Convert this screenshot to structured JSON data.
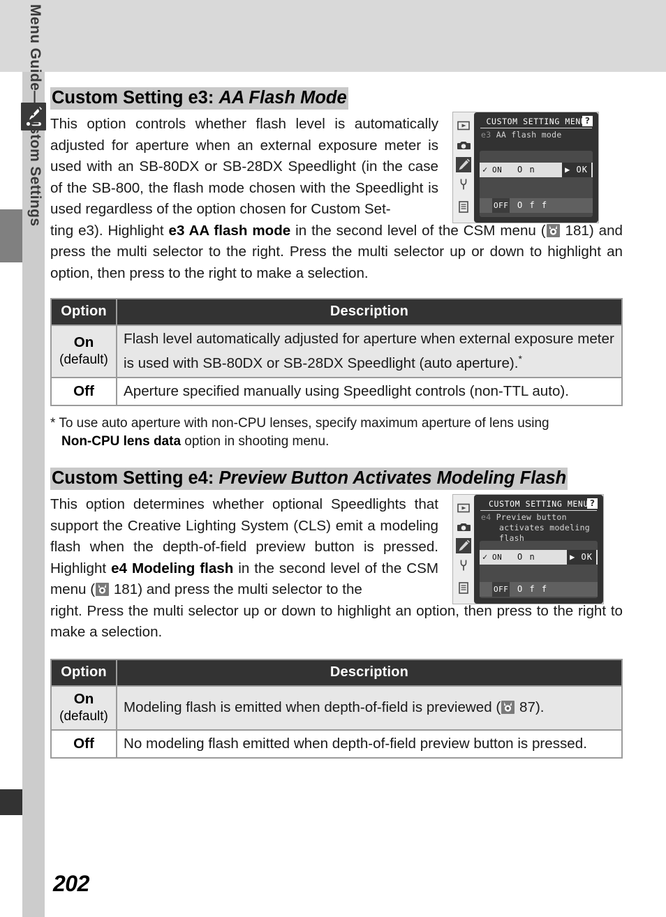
{
  "sidebar": {
    "label": "Menu Guide—Custom Settings",
    "tab_icon": "pencil-icon"
  },
  "page": {
    "number": "202"
  },
  "sections": [
    {
      "heading_prefix": "Custom Setting e3:",
      "heading_title": "AA Flash Mode",
      "body_narrow": "This option controls whether flash level is automatically adjusted for aperture when an external exposure meter is used with an SB-80DX or SB-28DX Speedlight (in the case of the SB-800, the flash mode chosen with the Speedlight is used regardless of the option chosen for Custom Set-",
      "body_full_1": "ting e3).  Highlight ",
      "body_full_bold": "e3 AA flash mode",
      "body_full_2": " in the second level of the CSM menu (",
      "body_full_page": "181",
      "body_full_3": ") and press the multi selector to the right.  Press the multi selector up or down to highlight an option, then press to the right to make a selection.",
      "lcd": {
        "title": "CUSTOM SETTING MENU",
        "help_glyph": "?",
        "index": "e3",
        "subtitle_lines": [
          "AA flash mode"
        ],
        "rows": [
          {
            "check": "✓",
            "abbr": "ON",
            "name": "O n",
            "selected": true,
            "ok": "▶ OK"
          },
          {
            "check": "",
            "abbr": "OFF",
            "name": "O f f",
            "selected": false,
            "ok": ""
          }
        ],
        "side_icons": [
          "playback-icon",
          "camera-icon",
          "pencil-icon",
          "wrench-icon",
          "recent-settings-icon"
        ]
      },
      "table": {
        "headers": [
          "Option",
          "Description"
        ],
        "rows": [
          {
            "option_name": "On",
            "option_default": "(default)",
            "description": "Flash level automatically adjusted for aperture when external exposure meter is used with SB-80DX or SB-28DX Speedlight (auto aperture).",
            "description_sup": "*",
            "shaded": true
          },
          {
            "option_name": "Off",
            "option_default": "",
            "description": "Aperture specified manually using Speedlight controls (non-TTL auto).",
            "description_sup": "",
            "shaded": false
          }
        ]
      },
      "footnote_1": "* To use auto aperture with non-CPU lenses, specify maximum aperture of lens using",
      "footnote_bold": "Non-CPU lens data",
      "footnote_2": " option in shooting menu."
    },
    {
      "heading_prefix": "Custom Setting e4:",
      "heading_title": "Preview Button Activates Modeling Flash",
      "body_narrow_1": "This option determines whether optional Speedlights that support the Creative Lighting System (CLS) emit a modeling flash when the depth-of-field preview button is pressed.   Highlight ",
      "body_narrow_bold_1": "e4 Modeling flash",
      "body_narrow_2": " in the second level of the CSM menu (",
      "body_narrow_page": "181",
      "body_narrow_3": ") and press the multi selector to the",
      "body_full": "right.  Press the multi selector up or down to highlight an option, then press to the right to make a selection.",
      "lcd": {
        "title": "CUSTOM SETTING MENU",
        "help_glyph": "?",
        "index": "e4",
        "subtitle_lines": [
          "Preview button",
          "activates modeling flash"
        ],
        "rows": [
          {
            "check": "✓",
            "abbr": "ON",
            "name": "O n",
            "selected": true,
            "ok": "▶ OK"
          },
          {
            "check": "",
            "abbr": "OFF",
            "name": "O f f",
            "selected": false,
            "ok": ""
          }
        ],
        "side_icons": [
          "playback-icon",
          "camera-icon",
          "pencil-icon",
          "wrench-icon",
          "recent-settings-icon"
        ]
      },
      "table": {
        "headers": [
          "Option",
          "Description"
        ],
        "rows": [
          {
            "option_name": "On",
            "option_default": "(default)",
            "description_1": "Modeling flash is emitted when depth-of-field is previewed (",
            "description_page": "87",
            "description_2": ").",
            "shaded": true
          },
          {
            "option_name": "Off",
            "option_default": "",
            "description_1": "No modeling flash emitted when depth-of-field preview button is pressed.",
            "description_page": "",
            "description_2": "",
            "shaded": false
          }
        ]
      }
    }
  ],
  "colors": {
    "top_band": "#d9d9d9",
    "sidebar": "#cccccc",
    "heading_highlight": "#c9c9c9",
    "table_header": "#333333",
    "table_shaded_row": "#e7e7e7",
    "table_border": "#9b9b9b",
    "lcd_screen": "#323232",
    "lcd_selected_row": "#e0e0e0",
    "tab_marker": "#808080"
  }
}
